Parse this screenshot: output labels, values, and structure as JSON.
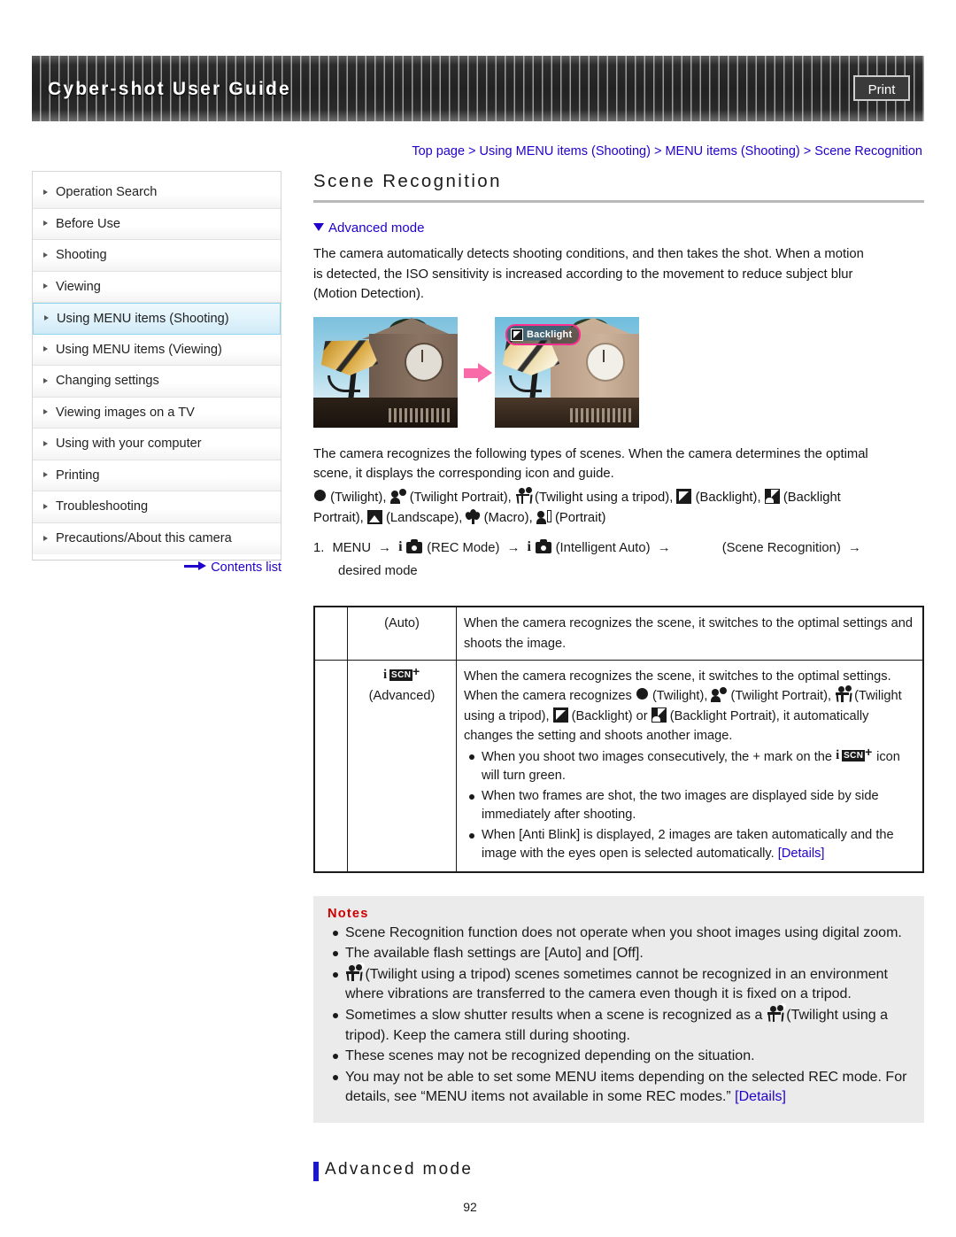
{
  "header": {
    "title": "Cyber-shot User Guide",
    "print_label": "Print"
  },
  "breadcrumb": {
    "text": "Top page > Using MENU items (Shooting) > MENU items (Shooting) > Scene Recognition"
  },
  "sidebar": {
    "items": [
      {
        "label": "Operation Search",
        "active": false
      },
      {
        "label": "Before Use",
        "active": false
      },
      {
        "label": "Shooting",
        "active": false
      },
      {
        "label": "Viewing",
        "active": false
      },
      {
        "label": "Using MENU items (Shooting)",
        "active": true
      },
      {
        "label": "Using MENU items (Viewing)",
        "active": false
      },
      {
        "label": "Changing settings",
        "active": false
      },
      {
        "label": "Viewing images on a TV",
        "active": false
      },
      {
        "label": "Using with your computer",
        "active": false
      },
      {
        "label": "Printing",
        "active": false
      },
      {
        "label": "Troubleshooting",
        "active": false
      },
      {
        "label": "Precautions/About this camera",
        "active": false
      }
    ],
    "contents_link": "Contents list"
  },
  "main": {
    "page_title": "Scene Recognition",
    "mode_link": "Advanced mode",
    "intro_p1": "The camera automatically detects shooting conditions, and then takes the shot. When a motion",
    "intro_p2": "is detected, the ISO sensitivity is increased according to the movement to reduce subject blur",
    "intro_p3": "(Motion Detection).",
    "figure": {
      "badge_label": "Backlight"
    },
    "scenes_p1": "The camera recognizes the following types of scenes. When the camera determines the optimal",
    "scenes_p2": "scene, it displays the corresponding icon and guide.",
    "scene_list": {
      "twilight": "(Twilight),",
      "twilight_portrait": "(Twilight Portrait),",
      "twilight_tripod": "(Twilight using a tripod),",
      "backlight": "(Backlight),",
      "backlight_portrait": "(Backlight",
      "portrait_cont": "Portrait),",
      "landscape": "(Landscape),",
      "macro": "(Macro),",
      "portrait": "(Portrait)"
    },
    "step": {
      "number": "1.",
      "menu": "MENU",
      "arrow": "→",
      "rec_mode": "(REC Mode)",
      "intelligent_auto": "(Intelligent Auto)",
      "scene_recognition": "(Scene Recognition)",
      "desired_mode": "desired mode"
    },
    "table": {
      "rows": [
        {
          "mode_label": "(Auto)",
          "icon": "auto-icon",
          "desc_lines": [
            "When the camera recognizes the scene, it switches to the optimal settings",
            "and shoots the image."
          ],
          "bullets": []
        },
        {
          "mode_label": "(Advanced)",
          "icon": "iscn-plus-icon",
          "desc_lines": [
            "When the camera recognizes the scene, it switches to the optimal settings.",
            "When the camera recognizes",
            "(Twilight),",
            "(Twilight Portrait),",
            "(Twilight",
            "using a tripod),",
            "(Backlight) or",
            "(Backlight Portrait), it automatically",
            "changes the setting and shoots another image."
          ],
          "bullets": [
            {
              "pre": "When you shoot two images consecutively, the + mark on the",
              "post": "icon",
              "line2": "will turn green."
            },
            {
              "pre": "When two frames are shot, the two images are displayed side by side",
              "post": "",
              "line2": "immediately after shooting."
            },
            {
              "pre": "When [Anti Blink] is displayed, 2 images are taken automatically and the",
              "post": "",
              "line2": "image with the eyes open is selected automatically.",
              "link": "[Details]"
            }
          ]
        }
      ]
    },
    "notes": {
      "title": "Notes",
      "items": [
        {
          "text": "Scene Recognition function does not operate when you shoot images using digital zoom."
        },
        {
          "text": "The available flash settings are [Auto] and [Off]."
        },
        {
          "icon": "twilight-tripod-icon",
          "text": "(Twilight using a tripod) scenes sometimes cannot be recognized in an environment",
          "line2": "where vibrations are transferred to the camera even though it is fixed on a tripod."
        },
        {
          "text": "Sometimes a slow shutter results when a scene is recognized as a",
          "icon_inline": "twilight-tripod-icon",
          "text2": "(Twilight using a",
          "line2": "tripod). Keep the camera still during shooting."
        },
        {
          "text": "These scenes may not be recognized depending on the situation."
        },
        {
          "text": "You may not be able to set some MENU items depending on the selected REC mode. For",
          "line2": "details, see “MENU items not available in some REC modes.”",
          "link": "[Details]"
        }
      ]
    },
    "footer_heading": "Advanced mode",
    "page_number": "92"
  }
}
